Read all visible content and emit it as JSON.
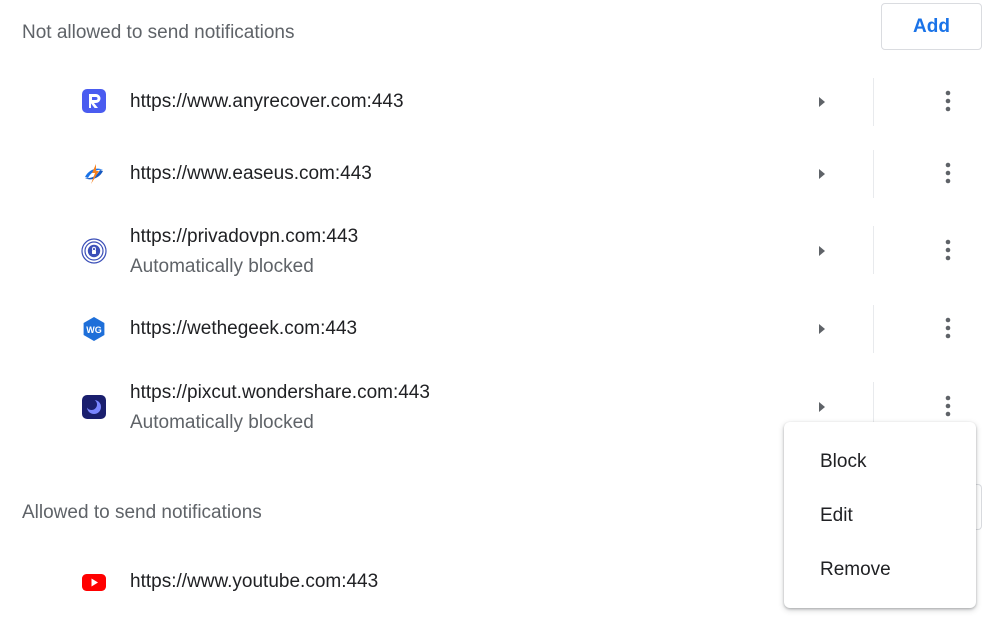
{
  "blocked": {
    "title": "Not allowed to send notifications",
    "add_label": "Add",
    "sites": [
      {
        "url": "https://www.anyrecover.com:443",
        "subtitle": ""
      },
      {
        "url": "https://www.easeus.com:443",
        "subtitle": ""
      },
      {
        "url": "https://privadovpn.com:443",
        "subtitle": "Automatically blocked"
      },
      {
        "url": "https://wethegeek.com:443",
        "subtitle": ""
      },
      {
        "url": "https://pixcut.wondershare.com:443",
        "subtitle": "Automatically blocked"
      }
    ]
  },
  "allowed": {
    "title": "Allowed to send notifications",
    "sites": [
      {
        "url": "https://www.youtube.com:443",
        "subtitle": ""
      }
    ]
  },
  "context_menu": {
    "items": [
      "Block",
      "Edit",
      "Remove"
    ]
  },
  "icons": {
    "site_anyrecover": "anyrecover-favicon-icon",
    "site_easeus": "easeus-favicon-icon",
    "site_privadovpn": "privadovpn-favicon-icon",
    "site_wethegeek": "wethegeek-favicon-icon",
    "site_pixcut": "pixcut-favicon-icon",
    "site_youtube": "youtube-favicon-icon",
    "expand": "arrow-right-icon",
    "more": "more-vert-icon"
  },
  "colors": {
    "accent": "#1a73e8",
    "text_primary": "#202124",
    "text_secondary": "#5f6368"
  }
}
